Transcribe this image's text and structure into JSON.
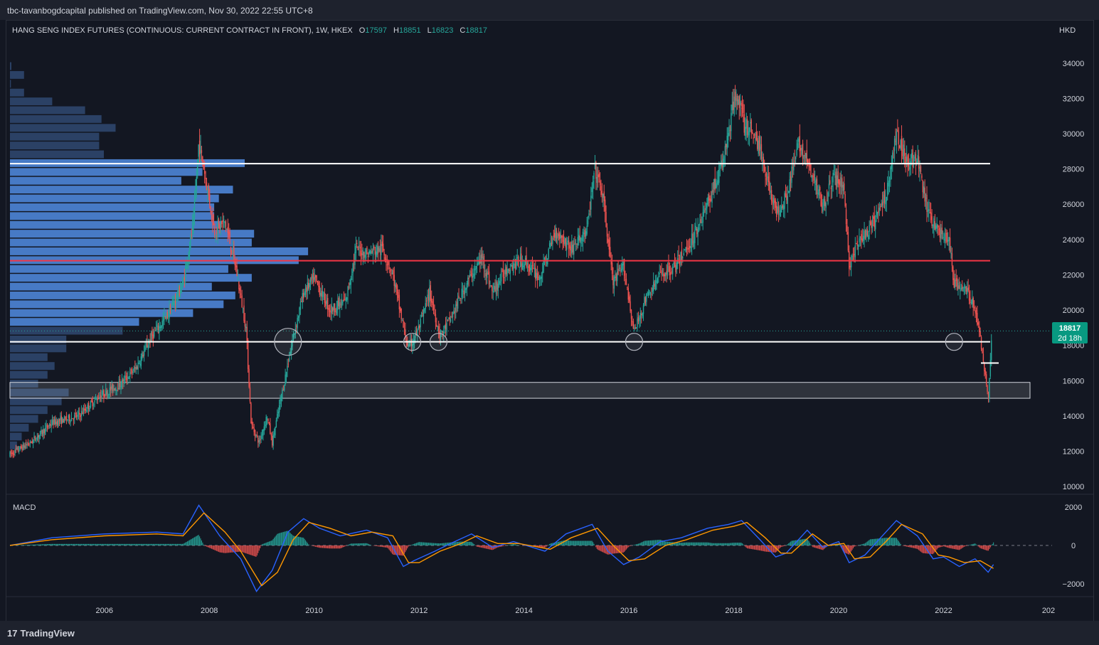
{
  "header": {
    "publisher": "tbc-tavanbogdcapital published on TradingView.com, Nov 30, 2022 22:55 UTC+8"
  },
  "footer": {
    "logo_mark": "17",
    "logo_text": "TradingView"
  },
  "chart_data": [
    {
      "type": "candlestick",
      "title": "HANG SENG INDEX FUTURES (CONTINUOUS: CURRENT CONTRACT IN FRONT), 1W, HKEX",
      "ohlc_labels": {
        "O": "17597",
        "H": "18851",
        "L": "16823",
        "C": "18817"
      },
      "currency": "HKD",
      "y_ticks": [
        "34000",
        "32000",
        "30000",
        "28000",
        "26000",
        "24000",
        "22000",
        "20000",
        "18000",
        "16000",
        "14000",
        "12000",
        "10000"
      ],
      "ylim": [
        9600,
        35200
      ],
      "x_ticks": [
        "2006",
        "2008",
        "2010",
        "2012",
        "2014",
        "2016",
        "2018",
        "2020",
        "2022",
        "202"
      ],
      "xlim": [
        2004.2,
        2024.0
      ],
      "last_price": {
        "value": 18817,
        "label": "18817",
        "countdown": "2d 18h"
      },
      "price_path": [
        [
          2004.2,
          11800
        ],
        [
          2004.6,
          12500
        ],
        [
          2005.0,
          13600
        ],
        [
          2005.5,
          14000
        ],
        [
          2005.9,
          15100
        ],
        [
          2006.3,
          15800
        ],
        [
          2006.6,
          16700
        ],
        [
          2006.9,
          18500
        ],
        [
          2007.2,
          19700
        ],
        [
          2007.5,
          21500
        ],
        [
          2007.7,
          25000
        ],
        [
          2007.8,
          29500
        ],
        [
          2007.9,
          28000
        ],
        [
          2008.1,
          24500
        ],
        [
          2008.3,
          25000
        ],
        [
          2008.5,
          22500
        ],
        [
          2008.7,
          19000
        ],
        [
          2008.8,
          13500
        ],
        [
          2008.95,
          12500
        ],
        [
          2009.1,
          14000
        ],
        [
          2009.2,
          12500
        ],
        [
          2009.4,
          15500
        ],
        [
          2009.6,
          18500
        ],
        [
          2009.8,
          21000
        ],
        [
          2010.0,
          21800
        ],
        [
          2010.3,
          20000
        ],
        [
          2010.6,
          20500
        ],
        [
          2010.8,
          23500
        ],
        [
          2011.0,
          23200
        ],
        [
          2011.3,
          23500
        ],
        [
          2011.5,
          22000
        ],
        [
          2011.7,
          19000
        ],
        [
          2011.8,
          17800
        ],
        [
          2012.0,
          19000
        ],
        [
          2012.2,
          21000
        ],
        [
          2012.4,
          18500
        ],
        [
          2012.6,
          19500
        ],
        [
          2012.9,
          21500
        ],
        [
          2013.2,
          23000
        ],
        [
          2013.4,
          21000
        ],
        [
          2013.7,
          22500
        ],
        [
          2014.0,
          22800
        ],
        [
          2014.3,
          21800
        ],
        [
          2014.6,
          24500
        ],
        [
          2014.9,
          23500
        ],
        [
          2015.2,
          24500
        ],
        [
          2015.35,
          28000
        ],
        [
          2015.5,
          26500
        ],
        [
          2015.7,
          21500
        ],
        [
          2015.9,
          22500
        ],
        [
          2016.1,
          18700
        ],
        [
          2016.3,
          20500
        ],
        [
          2016.6,
          22000
        ],
        [
          2016.9,
          22500
        ],
        [
          2017.2,
          24000
        ],
        [
          2017.5,
          26000
        ],
        [
          2017.8,
          28500
        ],
        [
          2018.05,
          32500
        ],
        [
          2018.2,
          30500
        ],
        [
          2018.4,
          30000
        ],
        [
          2018.6,
          28000
        ],
        [
          2018.8,
          25500
        ],
        [
          2019.0,
          26500
        ],
        [
          2019.25,
          29500
        ],
        [
          2019.5,
          27500
        ],
        [
          2019.7,
          26000
        ],
        [
          2019.9,
          27500
        ],
        [
          2020.1,
          27000
        ],
        [
          2020.2,
          22500
        ],
        [
          2020.4,
          24000
        ],
        [
          2020.6,
          24500
        ],
        [
          2020.9,
          26500
        ],
        [
          2021.1,
          30000
        ],
        [
          2021.3,
          28500
        ],
        [
          2021.5,
          28500
        ],
        [
          2021.7,
          25500
        ],
        [
          2021.9,
          24500
        ],
        [
          2022.1,
          24000
        ],
        [
          2022.2,
          21500
        ],
        [
          2022.4,
          21200
        ],
        [
          2022.55,
          20500
        ],
        [
          2022.7,
          18500
        ],
        [
          2022.8,
          16200
        ],
        [
          2022.85,
          15000
        ],
        [
          2022.92,
          18817
        ]
      ],
      "support_resistance_lines": [
        {
          "price": 28300,
          "color": "#ffffff"
        },
        {
          "price": 22800,
          "color": "#f23645"
        },
        {
          "price": 18200,
          "color": "#ffffff"
        }
      ],
      "support_zone": {
        "low": 15000,
        "high": 15900
      },
      "marked_lows": [
        {
          "x": 2009.5,
          "price": 18200
        },
        {
          "x": 2011.87,
          "price": 18200
        },
        {
          "x": 2012.37,
          "price": 18200
        },
        {
          "x": 2016.1,
          "price": 18200
        },
        {
          "x": 2022.2,
          "price": 18200
        }
      ],
      "volume_profile_rows": [
        [
          33800,
          0.006
        ],
        [
          33300,
          0.06
        ],
        [
          32800,
          0.004
        ],
        [
          32300,
          0.06
        ],
        [
          31800,
          0.18
        ],
        [
          31300,
          0.32
        ],
        [
          30800,
          0.39
        ],
        [
          30300,
          0.45
        ],
        [
          29800,
          0.38
        ],
        [
          29300,
          0.38
        ],
        [
          28800,
          0.4
        ],
        [
          28300,
          1.0
        ],
        [
          27800,
          0.82
        ],
        [
          27300,
          0.73
        ],
        [
          26800,
          0.95
        ],
        [
          26300,
          0.89
        ],
        [
          25800,
          0.87
        ],
        [
          25300,
          0.87
        ],
        [
          24800,
          0.9
        ],
        [
          24300,
          1.04
        ],
        [
          23800,
          1.03
        ],
        [
          23300,
          1.27
        ],
        [
          22800,
          1.23
        ],
        [
          22300,
          0.93
        ],
        [
          21800,
          1.03
        ],
        [
          21300,
          0.86
        ],
        [
          20800,
          0.96
        ],
        [
          20300,
          0.91
        ],
        [
          19800,
          0.78
        ],
        [
          19300,
          0.55
        ],
        [
          18800,
          0.48
        ],
        [
          18300,
          0.24
        ],
        [
          17800,
          0.24
        ],
        [
          17300,
          0.16
        ],
        [
          16800,
          0.19
        ],
        [
          16300,
          0.16
        ],
        [
          15800,
          0.12
        ],
        [
          15300,
          0.25
        ],
        [
          14800,
          0.22
        ],
        [
          14300,
          0.16
        ],
        [
          13800,
          0.12
        ],
        [
          13300,
          0.08
        ],
        [
          12800,
          0.05
        ],
        [
          12300,
          0.03
        ]
      ]
    },
    {
      "type": "line",
      "title": "MACD",
      "y_ticks": [
        "2000",
        "0",
        "−2000"
      ],
      "ylim": [
        -2600,
        2600
      ],
      "series": [
        {
          "color": "#2962ff",
          "points": [
            [
              2004.2,
              0
            ],
            [
              2005.0,
              400
            ],
            [
              2006.0,
              600
            ],
            [
              2007.0,
              700
            ],
            [
              2007.5,
              600
            ],
            [
              2007.8,
              2100
            ],
            [
              2008.2,
              500
            ],
            [
              2008.6,
              -700
            ],
            [
              2008.9,
              -2400
            ],
            [
              2009.2,
              -1300
            ],
            [
              2009.5,
              700
            ],
            [
              2009.8,
              1400
            ],
            [
              2010.1,
              900
            ],
            [
              2010.5,
              500
            ],
            [
              2011.0,
              800
            ],
            [
              2011.4,
              400
            ],
            [
              2011.7,
              -1100
            ],
            [
              2011.9,
              -800
            ],
            [
              2012.3,
              -300
            ],
            [
              2012.6,
              100
            ],
            [
              2013.0,
              600
            ],
            [
              2013.4,
              -100
            ],
            [
              2013.8,
              200
            ],
            [
              2014.4,
              -300
            ],
            [
              2014.8,
              600
            ],
            [
              2015.3,
              1100
            ],
            [
              2015.6,
              -300
            ],
            [
              2015.9,
              -1000
            ],
            [
              2016.2,
              -600
            ],
            [
              2016.6,
              200
            ],
            [
              2017.0,
              400
            ],
            [
              2017.5,
              900
            ],
            [
              2017.9,
              1100
            ],
            [
              2018.15,
              1300
            ],
            [
              2018.5,
              300
            ],
            [
              2018.8,
              -600
            ],
            [
              2019.0,
              -400
            ],
            [
              2019.4,
              800
            ],
            [
              2019.7,
              -100
            ],
            [
              2020.0,
              200
            ],
            [
              2020.2,
              -900
            ],
            [
              2020.5,
              -500
            ],
            [
              2020.8,
              400
            ],
            [
              2021.1,
              1300
            ],
            [
              2021.5,
              500
            ],
            [
              2021.8,
              -700
            ],
            [
              2022.0,
              -600
            ],
            [
              2022.3,
              -1100
            ],
            [
              2022.6,
              -700
            ],
            [
              2022.85,
              -1400
            ],
            [
              2022.95,
              -1000
            ]
          ]
        },
        {
          "color": "#ff9800",
          "points": [
            [
              2004.2,
              0
            ],
            [
              2005.0,
              300
            ],
            [
              2006.0,
              500
            ],
            [
              2007.0,
              600
            ],
            [
              2007.5,
              500
            ],
            [
              2007.9,
              1700
            ],
            [
              2008.3,
              700
            ],
            [
              2008.6,
              -300
            ],
            [
              2009.0,
              -2100
            ],
            [
              2009.3,
              -1400
            ],
            [
              2009.6,
              300
            ],
            [
              2009.9,
              1200
            ],
            [
              2010.3,
              900
            ],
            [
              2010.7,
              500
            ],
            [
              2011.1,
              700
            ],
            [
              2011.5,
              500
            ],
            [
              2011.8,
              -900
            ],
            [
              2012.0,
              -900
            ],
            [
              2012.4,
              -300
            ],
            [
              2012.8,
              100
            ],
            [
              2013.1,
              500
            ],
            [
              2013.5,
              100
            ],
            [
              2013.9,
              100
            ],
            [
              2014.5,
              -200
            ],
            [
              2014.9,
              400
            ],
            [
              2015.4,
              900
            ],
            [
              2015.7,
              0
            ],
            [
              2016.0,
              -800
            ],
            [
              2016.3,
              -700
            ],
            [
              2016.7,
              0
            ],
            [
              2017.1,
              300
            ],
            [
              2017.6,
              800
            ],
            [
              2018.0,
              1000
            ],
            [
              2018.25,
              1200
            ],
            [
              2018.6,
              400
            ],
            [
              2018.9,
              -400
            ],
            [
              2019.1,
              -400
            ],
            [
              2019.5,
              600
            ],
            [
              2019.8,
              0
            ],
            [
              2020.1,
              100
            ],
            [
              2020.3,
              -700
            ],
            [
              2020.6,
              -600
            ],
            [
              2020.9,
              200
            ],
            [
              2021.2,
              1100
            ],
            [
              2021.6,
              600
            ],
            [
              2021.9,
              -500
            ],
            [
              2022.1,
              -600
            ],
            [
              2022.4,
              -900
            ],
            [
              2022.7,
              -800
            ],
            [
              2022.95,
              -1200
            ]
          ]
        }
      ]
    }
  ]
}
